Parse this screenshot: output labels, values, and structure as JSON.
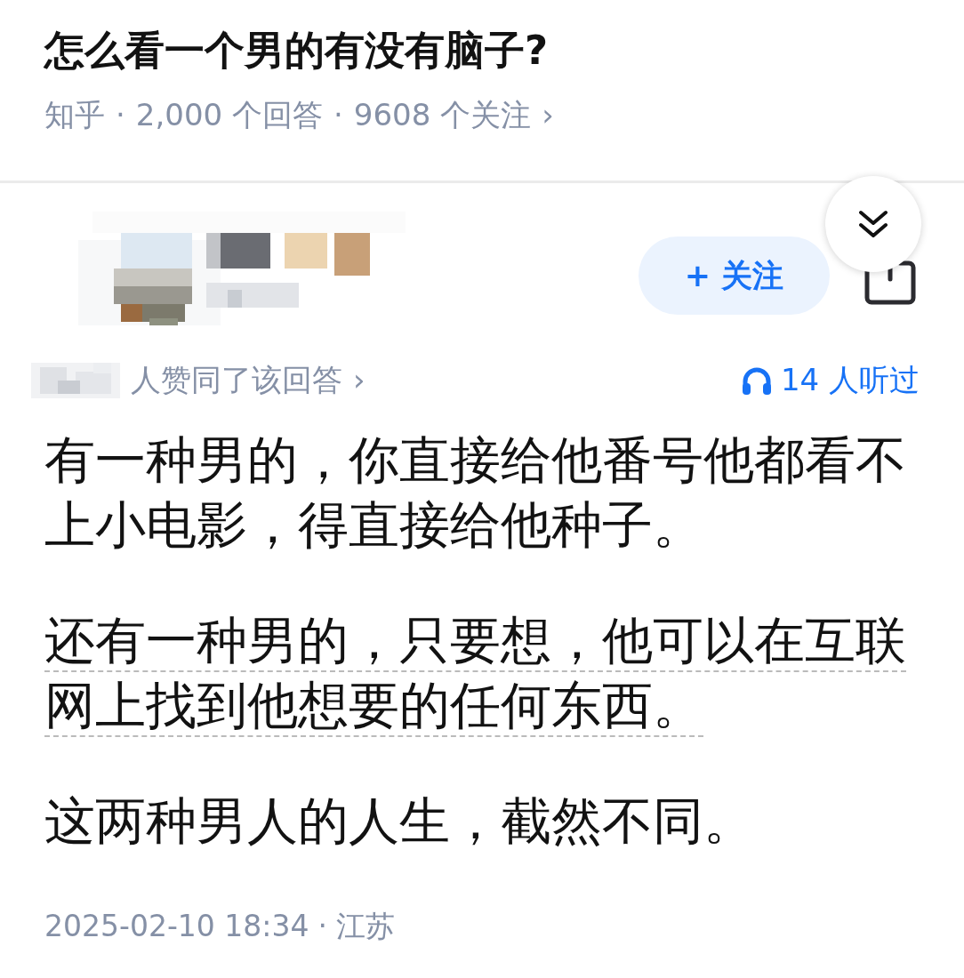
{
  "question": {
    "title": "怎么看一个男的有没有脑子?",
    "meta": [
      "知乎",
      "2,000 个回答",
      "9608 个关注"
    ],
    "meta_chevron": "›",
    "separator": "·"
  },
  "answer": {
    "follow_button": {
      "icon": "+",
      "label": "关注",
      "followed": false
    },
    "votes": "人赞同了该回答",
    "votes_chevron": "›",
    "listeners": "14 人听过",
    "paragraphs": [
      {
        "kind": "plain",
        "text": "有一种男的，你直接给他番号他都看不上小电影，得直接给他种子。"
      },
      {
        "kind": "underlined",
        "text": "还有一种男的，只要想，他可以在互联网上找到他想要的任何东西。"
      },
      {
        "kind": "plain",
        "text": "这两种男人的人生，截然不同。"
      }
    ],
    "footer": [
      "2025-02-10 18:34",
      "江苏"
    ],
    "footer_separator": "·"
  }
}
